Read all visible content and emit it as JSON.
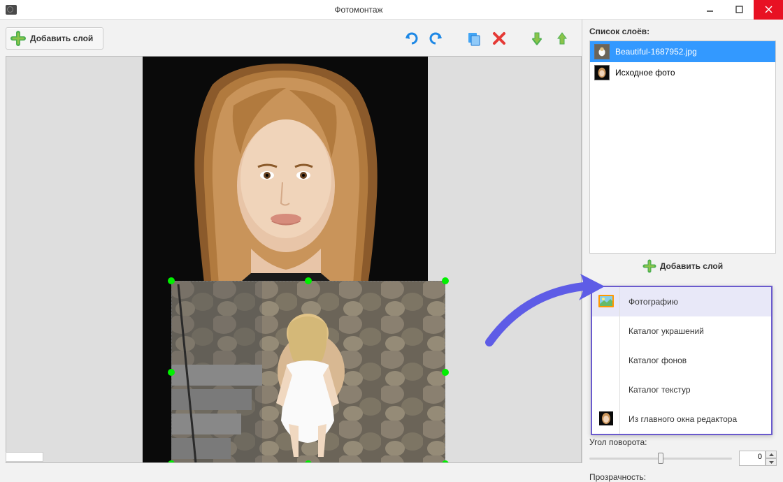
{
  "window": {
    "title": "Фотомонтаж"
  },
  "toolbar": {
    "add_layer_label": "Добавить слой"
  },
  "layers_panel": {
    "heading": "Список слоёв:",
    "items": [
      {
        "label": "Beautiful-1687952.jpg",
        "selected": true
      },
      {
        "label": "Исходное фото",
        "selected": false
      }
    ],
    "add_layer_label": "Добавить слой"
  },
  "dropdown": {
    "items": [
      {
        "label": "Фотографию",
        "highlighted": true,
        "icon": "image"
      },
      {
        "label": "Каталог украшений",
        "highlighted": false,
        "icon": ""
      },
      {
        "label": "Каталог фонов",
        "highlighted": false,
        "icon": ""
      },
      {
        "label": "Каталог текстур",
        "highlighted": false,
        "icon": ""
      },
      {
        "label": "Из главного окна редактора",
        "highlighted": false,
        "icon": "portrait"
      }
    ]
  },
  "controls": {
    "rotation_label": "Угол поворота:",
    "rotation_value": "0",
    "opacity_label": "Прозрачность:"
  }
}
